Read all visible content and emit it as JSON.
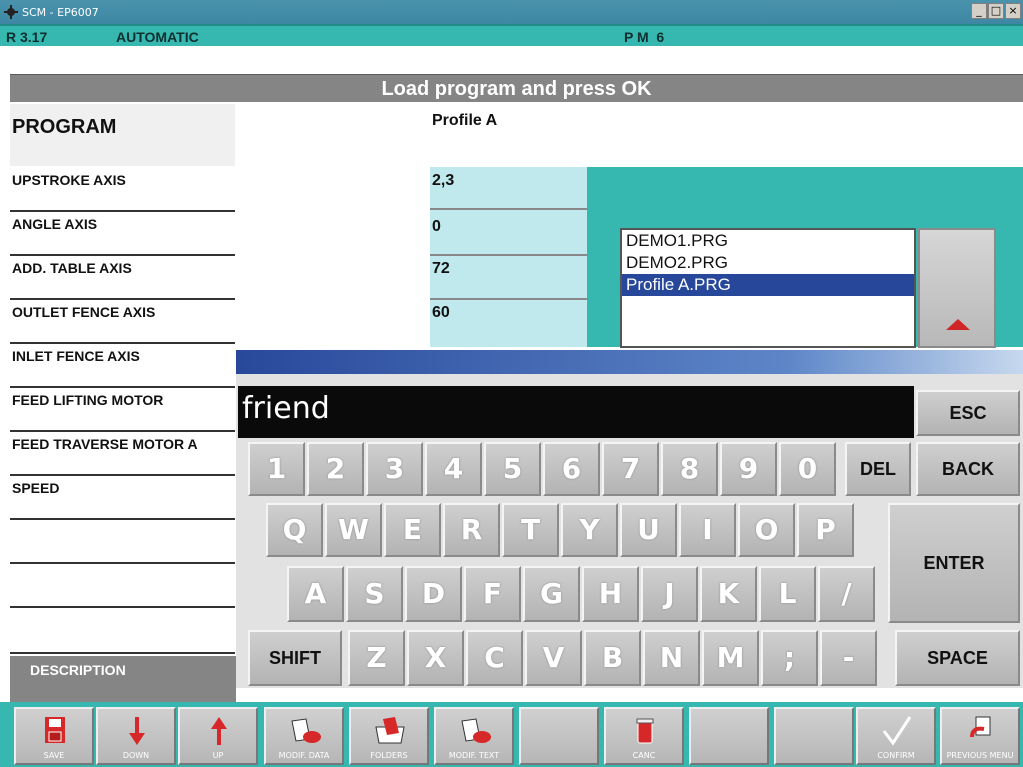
{
  "window": {
    "title": "SCM - EP6007",
    "controls": [
      "_",
      "□",
      "×"
    ]
  },
  "status": {
    "version": "R 3.17",
    "mode": "AUTOMATIC",
    "pm": "P M  6"
  },
  "prompt": "Load program and press OK",
  "program": {
    "label": "PROGRAM",
    "value": "Profile A"
  },
  "fields": [
    {
      "label": "UPSTROKE AXIS",
      "value": "2,3"
    },
    {
      "label": "ANGLE AXIS",
      "value": "0"
    },
    {
      "label": "ADD. TABLE AXIS",
      "value": "72"
    },
    {
      "label": "OUTLET FENCE AXIS",
      "value": "60"
    },
    {
      "label": "INLET FENCE AXIS",
      "value": ""
    },
    {
      "label": "FEED LIFTING MOTOR",
      "value": ""
    },
    {
      "label": "FEED TRAVERSE MOTOR A",
      "value": ""
    },
    {
      "label": "SPEED",
      "value": ""
    }
  ],
  "files": [
    "DEMO1.PRG",
    "DEMO2.PRG",
    "Profile A.PRG"
  ],
  "selected_file": "Profile A.PRG",
  "keyboard": {
    "input_value": "friend",
    "row1": [
      "1",
      "2",
      "3",
      "4",
      "5",
      "6",
      "7",
      "8",
      "9",
      "0"
    ],
    "row2": [
      "Q",
      "W",
      "E",
      "R",
      "T",
      "Y",
      "U",
      "I",
      "O",
      "P"
    ],
    "row3": [
      "A",
      "S",
      "D",
      "F",
      "G",
      "H",
      "J",
      "K",
      "L",
      "/"
    ],
    "row4": [
      "Z",
      "X",
      "C",
      "V",
      "B",
      "N",
      "M",
      ";",
      "-"
    ],
    "esc": "ESC",
    "del": "DEL",
    "back": "BACK",
    "enter": "ENTER",
    "shift": "SHIFT",
    "space": "SPACE"
  },
  "description_label": "DESCRIPTION",
  "toolbar": [
    {
      "label": "SAVE",
      "icon": "save-icon"
    },
    {
      "label": "DOWN",
      "icon": "arrow-down-icon"
    },
    {
      "label": "UP",
      "icon": "arrow-up-icon"
    },
    {
      "label": "MODIF. DATA",
      "icon": "modify-data-icon"
    },
    {
      "label": "FOLDERS",
      "icon": "folder-icon"
    },
    {
      "label": "MODIF. TEXT",
      "icon": "modify-text-icon"
    },
    {
      "label": "",
      "icon": ""
    },
    {
      "label": "CANC",
      "icon": "trash-icon"
    },
    {
      "label": "",
      "icon": ""
    },
    {
      "label": "",
      "icon": ""
    },
    {
      "label": "CONFIRM",
      "icon": "checkmark-icon"
    },
    {
      "label": "PREVIOUS MENU",
      "icon": "previous-menu-icon"
    }
  ],
  "colors": {
    "teal": "#36b8b0",
    "selection": "#27479a",
    "prompt_bg": "#858585"
  }
}
